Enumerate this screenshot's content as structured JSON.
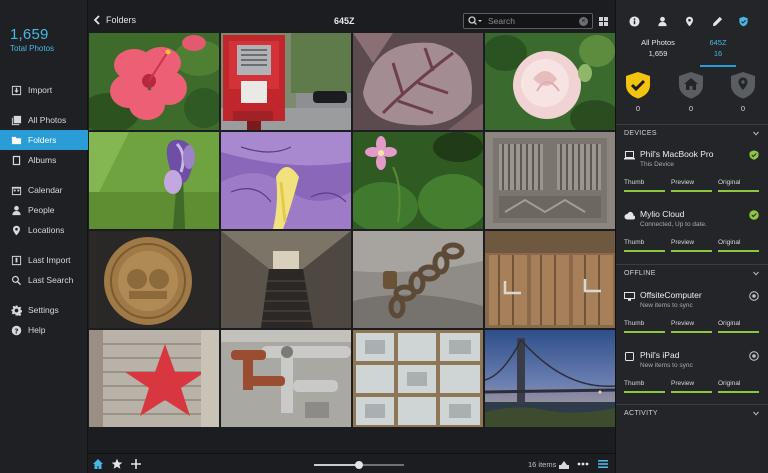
{
  "sidebar": {
    "total_count": "1,659",
    "total_label": "Total Photos",
    "items": [
      {
        "label": "Import"
      },
      {
        "label": "All Photos"
      },
      {
        "label": "Folders"
      },
      {
        "label": "Albums"
      },
      {
        "label": "Calendar"
      },
      {
        "label": "People"
      },
      {
        "label": "Locations"
      },
      {
        "label": "Last Import"
      },
      {
        "label": "Last Search"
      },
      {
        "label": "Settings"
      },
      {
        "label": "Help"
      }
    ],
    "active_item": "Folders"
  },
  "topbar": {
    "back_label": "Folders",
    "title": "645Z",
    "search_placeholder": "Search"
  },
  "grid": {
    "photos": [
      "hibiscus",
      "fire-alarm-box",
      "frosted-leaf",
      "pink-rose",
      "purple-bud",
      "purple-iris",
      "pink-wildflower",
      "metal-door",
      "bronze-coin",
      "subway-escalator",
      "chain-lock",
      "barn-doors",
      "star-graffiti",
      "pipes",
      "glass-blocks",
      "bridge-sunset"
    ]
  },
  "bottombar": {
    "zoom_fraction": 0.5,
    "count_label": "16 items"
  },
  "right_panel": {
    "stats": [
      {
        "label": "All Photos",
        "value": "1,659"
      },
      {
        "label": "645Z",
        "value": "16"
      }
    ],
    "protection": [
      {
        "value": "0",
        "color": "#f2c40f"
      },
      {
        "value": "0",
        "color": "#5a5d61"
      },
      {
        "value": "0",
        "color": "#5a5d61"
      }
    ],
    "sections": {
      "devices": "DEVICES",
      "offline": "OFFLINE",
      "activity": "ACTIVITY"
    },
    "devices": [
      {
        "name": "Phil's MacBook Pro",
        "sub": "This Device",
        "levels": [
          "Thumb",
          "Preview",
          "Original"
        ]
      },
      {
        "name": "Mylio Cloud",
        "sub": "Connected, Up to date.",
        "levels": [
          "Thumb",
          "Preview",
          "Original"
        ]
      }
    ],
    "offline": [
      {
        "name": "OffsiteComputer",
        "sub": "New items to sync",
        "levels": [
          "Thumb",
          "Preview",
          "Original"
        ]
      },
      {
        "name": "Phil's iPad",
        "sub": "New items to sync",
        "levels": [
          "Thumb",
          "Preview",
          "Original"
        ]
      }
    ],
    "colors": {
      "accent": "#2b9dd6",
      "synced": "#8fc63f",
      "warn": "#f2c40f"
    }
  }
}
